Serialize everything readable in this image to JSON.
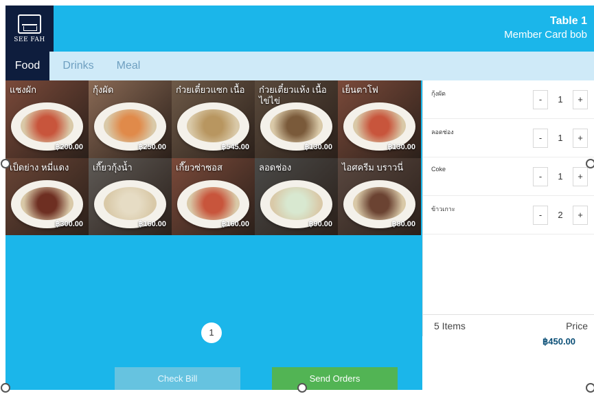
{
  "header": {
    "logo_text": "SEE FAH",
    "table_title": "Table 1",
    "member_card": "Member Card bob"
  },
  "tabs": [
    {
      "label": "Food",
      "active": true
    },
    {
      "label": "Drinks",
      "active": false
    },
    {
      "label": "Meal",
      "active": false
    }
  ],
  "menu_items": [
    {
      "name": "แชงผัก",
      "price": "฿200.00",
      "bg": "#7b4a3a",
      "food": "#c8553c"
    },
    {
      "name": "กุ้งผัด",
      "price": "฿250.00",
      "bg": "#8a6a55",
      "food": "#e08a4a"
    },
    {
      "name": "ก๋วยเตี๋ยวแซก เนื้อ",
      "price": "฿545.00",
      "bg": "#6e5a48",
      "food": "#b89660"
    },
    {
      "name": "ก๋วยเตี๋ยวแห้ง เนื้อ ไข่ไข่",
      "price": "฿130.00",
      "bg": "#5a4a3c",
      "food": "#7a5a3a"
    },
    {
      "name": "เย็นตาโฟ",
      "price": "฿130.00",
      "bg": "#7b4a3a",
      "food": "#c8553c"
    },
    {
      "name": "เป็ดย่าง หมี่แดง",
      "price": "฿300.00",
      "bg": "#6a4536",
      "food": "#6e2f22"
    },
    {
      "name": "เกี๊ยวกุ้งน้ำ",
      "price": "฿160.00",
      "bg": "#5e5a56",
      "food": "#e6dcc4"
    },
    {
      "name": "เกี๊ยวซ่าซอส",
      "price": "฿160.00",
      "bg": "#7b4a3a",
      "food": "#c8553c"
    },
    {
      "name": "ลอดช่อง",
      "price": "฿90.00",
      "bg": "#4a4a48",
      "food": "#d8e8d0"
    },
    {
      "name": "ไอศครีม บราวนี่",
      "price": "฿80.00",
      "bg": "#5a4840",
      "food": "#6b4332"
    }
  ],
  "pagination": {
    "current_page": "1"
  },
  "order": {
    "items": [
      {
        "name": "กุ้งผัด",
        "qty": "1"
      },
      {
        "name": "ลอดช่อง",
        "qty": "1"
      },
      {
        "name": "Coke",
        "qty": "1"
      },
      {
        "name": "ข้าวเกาะ",
        "qty": "2"
      }
    ],
    "minus_label": "-",
    "plus_label": "+",
    "items_count": "5 Items",
    "price_label": "Price",
    "total": "฿450.00"
  },
  "actions": {
    "check_bill": "Check Bill",
    "send_orders": "Send Orders"
  },
  "colors": {
    "header_bg": "#1bb6ea",
    "logo_bg": "#0e1d3d",
    "tab_bar_bg": "#cfeaf8",
    "check_bill_bg": "#66c3e0",
    "send_orders_bg": "#52b454"
  }
}
